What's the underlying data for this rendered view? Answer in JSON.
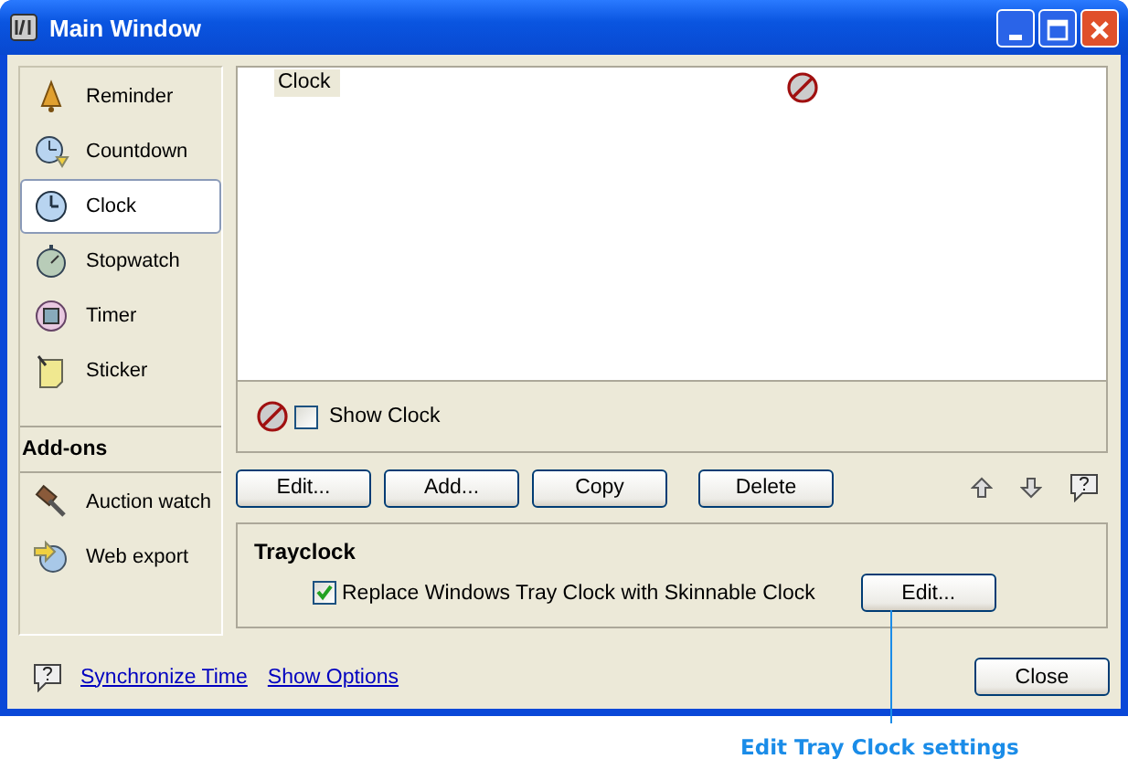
{
  "window": {
    "title": "Main Window"
  },
  "sidebar": {
    "items": [
      {
        "label": "Reminder",
        "selected": false
      },
      {
        "label": "Countdown",
        "selected": false
      },
      {
        "label": "Clock",
        "selected": true
      },
      {
        "label": "Stopwatch",
        "selected": false
      },
      {
        "label": "Timer",
        "selected": false
      },
      {
        "label": "Sticker",
        "selected": false
      }
    ],
    "addons_header": "Add-ons",
    "addon_items": [
      {
        "label": "Auction watch"
      },
      {
        "label": "Web export"
      }
    ]
  },
  "list": {
    "items": [
      {
        "label": "Clock"
      }
    ],
    "show_clock": {
      "label": "Show Clock",
      "checked": false
    }
  },
  "buttons": [
    "Edit...",
    "Add...",
    "Copy",
    "Delete"
  ],
  "trayclock": {
    "title": "Trayclock",
    "replace": {
      "label": "Replace Windows Tray Clock with Skinnable Clock",
      "checked": true
    },
    "edit_button": "Edit..."
  },
  "links": [
    "Synchronize Time",
    "Show Options"
  ],
  "close_button": "Close",
  "annotation": "Edit Tray Clock settings"
}
